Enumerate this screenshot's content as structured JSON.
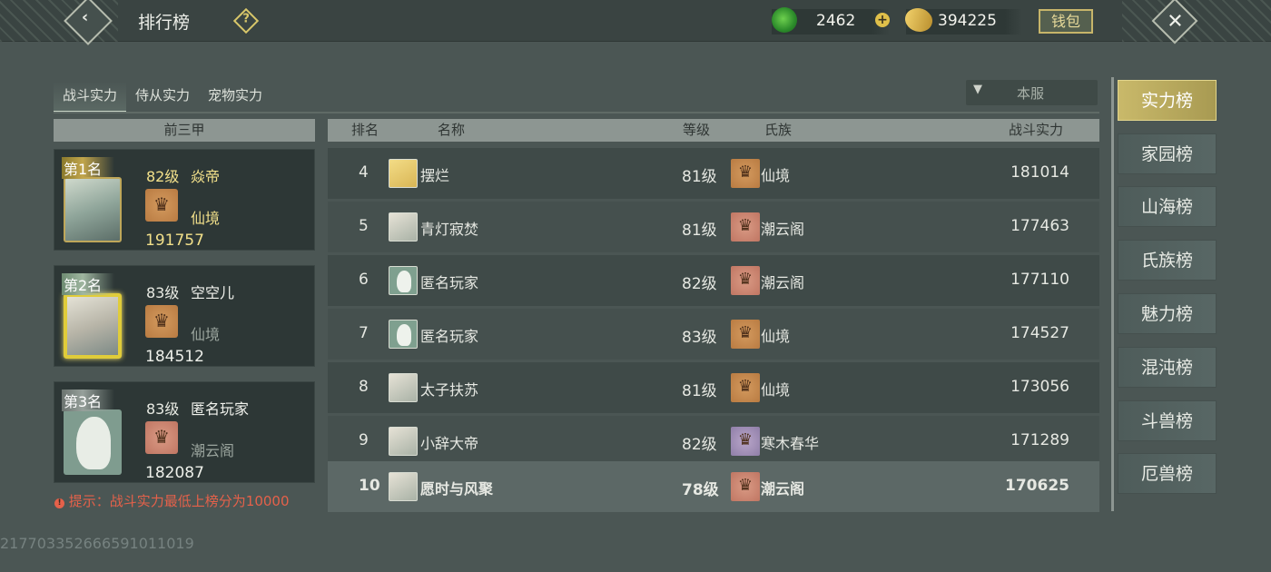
{
  "header": {
    "title": "排行榜",
    "jade_amount": "2462",
    "gold_amount": "394225",
    "wallet_label": "钱包"
  },
  "tabs": [
    {
      "label": "战斗实力",
      "active": true
    },
    {
      "label": "侍从实力",
      "active": false
    },
    {
      "label": "宠物实力",
      "active": false
    }
  ],
  "server_filter": {
    "label": "本服"
  },
  "top_three": {
    "header": "前三甲",
    "cards": [
      {
        "rank_label": "第1名",
        "level": "82级",
        "name": "焱帝",
        "clan": "仙境",
        "power": "191757"
      },
      {
        "rank_label": "第2名",
        "level": "83级",
        "name": "空空儿",
        "clan": "仙境",
        "power": "184512"
      },
      {
        "rank_label": "第3名",
        "level": "83级",
        "name": "匿名玩家",
        "clan": "潮云阁",
        "power": "182087"
      }
    ]
  },
  "tip": {
    "icon": "!",
    "text": "提示：战斗实力最低上榜分为10000"
  },
  "table": {
    "headers": {
      "rank": "排名",
      "name": "名称",
      "level": "等级",
      "clan": "氏族",
      "power": "战斗实力"
    },
    "rows": [
      {
        "rank": "4",
        "name": "摆烂",
        "level": "81级",
        "clan": "仙境",
        "power": "181014"
      },
      {
        "rank": "5",
        "name": "青灯寂焚",
        "level": "81级",
        "clan": "潮云阁",
        "power": "177463"
      },
      {
        "rank": "6",
        "name": "匿名玩家",
        "level": "82级",
        "clan": "潮云阁",
        "power": "177110"
      },
      {
        "rank": "7",
        "name": "匿名玩家",
        "level": "83级",
        "clan": "仙境",
        "power": "174527"
      },
      {
        "rank": "8",
        "name": "太子扶苏",
        "level": "81级",
        "clan": "仙境",
        "power": "173056"
      },
      {
        "rank": "9",
        "name": "小辞大帝",
        "level": "82级",
        "clan": "寒木春华",
        "power": "171289"
      },
      {
        "rank": "10",
        "name": "愿时与风聚",
        "level": "78级",
        "clan": "潮云阁",
        "power": "170625"
      }
    ]
  },
  "side_nav": [
    {
      "label": "实力榜",
      "active": true
    },
    {
      "label": "家园榜",
      "active": false
    },
    {
      "label": "山海榜",
      "active": false
    },
    {
      "label": "氏族榜",
      "active": false
    },
    {
      "label": "魅力榜",
      "active": false
    },
    {
      "label": "混沌榜",
      "active": false
    },
    {
      "label": "斗兽榜",
      "active": false
    },
    {
      "label": "厄兽榜",
      "active": false
    }
  ],
  "footer_id": "217703352666591011019",
  "icons": {
    "back": "back-arrow-icon",
    "help": "help-icon",
    "jade": "jade-coin-icon",
    "gold": "gold-ingot-icon",
    "add": "plus-icon",
    "close": "close-icon",
    "dropdown": "chevron-down-icon"
  },
  "colors": {
    "accent_gold": "#c9b96a",
    "tip_red": "#e5614a",
    "background": "#4b5654"
  }
}
